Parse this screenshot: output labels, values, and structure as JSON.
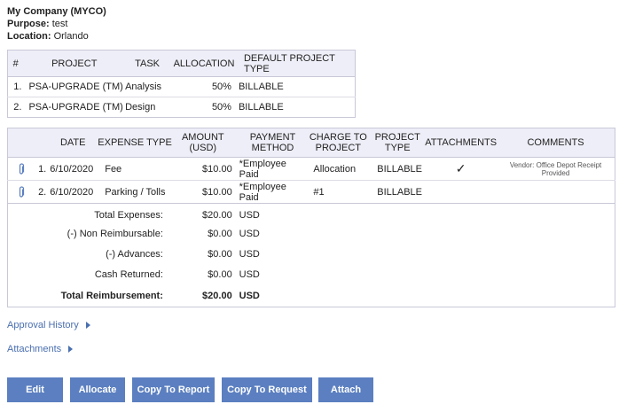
{
  "header": {
    "company": "My Company (MYCO)",
    "purpose_label": "Purpose:",
    "purpose_value": "test",
    "location_label": "Location:",
    "location_value": "Orlando"
  },
  "allocation_table": {
    "columns": [
      "#",
      "PROJECT",
      "TASK",
      "ALLOCATION",
      "DEFAULT PROJECT TYPE"
    ],
    "rows": [
      {
        "num": "1.",
        "project": "PSA-UPGRADE (TM)",
        "task": "Analysis",
        "allocation": "50%",
        "type": "BILLABLE"
      },
      {
        "num": "2.",
        "project": "PSA-UPGRADE (TM)",
        "task": "Design",
        "allocation": "50%",
        "type": "BILLABLE"
      }
    ]
  },
  "expense_table": {
    "columns": {
      "date": "DATE",
      "expense_type": "EXPENSE TYPE",
      "amount_1": "AMOUNT",
      "amount_2": "(USD)",
      "payment_1": "PAYMENT",
      "payment_2": "METHOD",
      "charge_1": "CHARGE TO",
      "charge_2": "PROJECT",
      "ptype_1": "PROJECT",
      "ptype_2": "TYPE",
      "attachments": "ATTACHMENTS",
      "comments": "COMMENTS"
    },
    "rows": [
      {
        "num": "1.",
        "date": "6/10/2020",
        "expense_type": "Fee",
        "amount": "$10.00",
        "payment": "*Employee Paid",
        "charge": "Allocation",
        "ptype": "BILLABLE",
        "attachment": "✓",
        "comment": "Vendor: Office Depot Receipt Provided"
      },
      {
        "num": "2.",
        "date": "6/10/2020",
        "expense_type": "Parking / Tolls",
        "amount": "$10.00",
        "payment": "*Employee Paid",
        "charge": "#1",
        "ptype": "BILLABLE",
        "attachment": "",
        "comment": ""
      }
    ],
    "totals": [
      {
        "label": "Total Expenses:",
        "value": "$20.00",
        "currency": "USD"
      },
      {
        "label": "(-) Non Reimbursable:",
        "value": "$0.00",
        "currency": "USD"
      },
      {
        "label": "(-) Advances:",
        "value": "$0.00",
        "currency": "USD"
      },
      {
        "label": "Cash Returned:",
        "value": "$0.00",
        "currency": "USD"
      },
      {
        "label": "Total Reimbursement:",
        "value": "$20.00",
        "currency": "USD"
      }
    ]
  },
  "links": {
    "approval_history": "Approval History",
    "attachments": "Attachments"
  },
  "buttons": {
    "edit": "Edit",
    "allocate": "Allocate",
    "copy_to_report": "Copy To Report",
    "copy_to_request": "Copy To Request",
    "attach": "Attach"
  },
  "colors": {
    "button_bg": "#5b7fc0",
    "link": "#4a6fb0",
    "table_header_bg": "#eeeef8",
    "paperclip": "#5b7fc0"
  },
  "icons": {
    "paperclip": "paperclip-icon",
    "check": "checkmark-icon",
    "expand": "triangle-right-icon"
  }
}
